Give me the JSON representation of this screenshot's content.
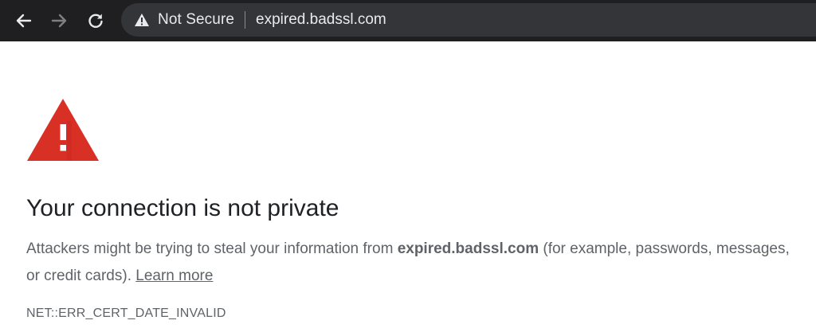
{
  "browser": {
    "back_icon": "back-arrow-icon",
    "forward_icon": "forward-arrow-icon",
    "reload_icon": "reload-icon",
    "security_icon": "warning-triangle-icon",
    "security_text": "Not Secure",
    "url": "expired.badssl.com",
    "toolbar_color": "#1f1f21",
    "omnibox_color": "#333538"
  },
  "interstitial": {
    "warning_icon": "warning-triangle-icon",
    "warning_color": "#d93025",
    "heading": "Your connection is not private",
    "explanation_before": "Attackers might be trying to steal your information from ",
    "explanation_domain": "expired.badssl.com",
    "explanation_after": " (for example, passwords, messages, or credit cards). ",
    "learn_more": "Learn more",
    "error_code": "NET::ERR_CERT_DATE_INVALID"
  }
}
